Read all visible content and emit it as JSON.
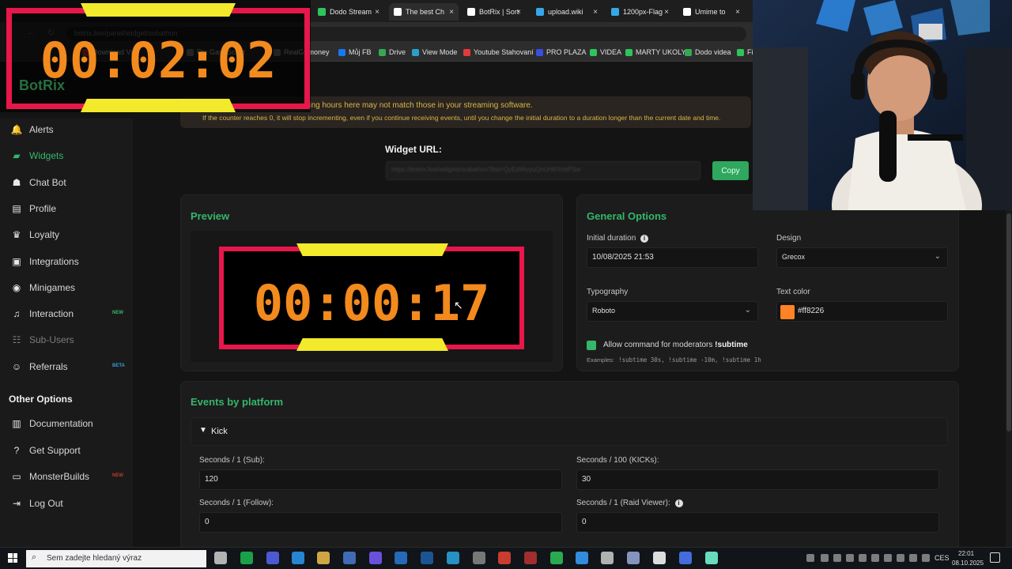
{
  "overlay_timer": {
    "time": "00:02:02",
    "brand": "BotRix"
  },
  "browser": {
    "tabs": [
      {
        "label": "Dodo Stream",
        "color": "#2ec45b",
        "active": false
      },
      {
        "label": "The best Ch",
        "color": "#ffffff",
        "active": true
      },
      {
        "label": "BotRix | Sort",
        "color": "#ffffff",
        "active": false
      },
      {
        "label": "upload.wiki",
        "color": "#36a6e8",
        "active": false
      },
      {
        "label": "1200px-Flag",
        "color": "#36a6e8",
        "active": false
      },
      {
        "label": "Umime to",
        "color": "#ffffff",
        "active": false
      }
    ],
    "url": "botrix.live/panel/widget/subathon",
    "bookmarks": [
      {
        "label": "Download Vi",
        "color": "#e23b3b"
      },
      {
        "label": "Rtx Gam Script",
        "color": "#888888"
      },
      {
        "label": "RealGemoney",
        "color": "#888888"
      },
      {
        "label": "Můj FB",
        "color": "#1877f2"
      },
      {
        "label": "Drive",
        "color": "#34a853"
      },
      {
        "label": "View Mode",
        "color": "#2aa0c8"
      },
      {
        "label": "Youtube Stahovaní",
        "color": "#e23b3b"
      },
      {
        "label": "PRO PLAZA",
        "color": "#3b4de2"
      },
      {
        "label": "VIDEA",
        "color": "#2ec45b"
      },
      {
        "label": "MARTY UKOLY",
        "color": "#2ec45b"
      },
      {
        "label": "Dodo videa",
        "color": "#34a853"
      },
      {
        "label": "Fi",
        "color": "#2ec45b"
      }
    ]
  },
  "banner": {
    "line1": "aining hours here may not match those in your streaming software.",
    "line2": "If the counter reaches 0, it will stop incrementing, even if you continue receiving events, until you change the initial duration to a duration longer than the current date and time."
  },
  "sidebar": {
    "items": [
      {
        "label": "Alerts",
        "icon": "bell-icon",
        "glyph": "🔔",
        "state": "normal"
      },
      {
        "label": "Widgets",
        "icon": "layers-icon",
        "glyph": "▰",
        "state": "active"
      },
      {
        "label": "Chat Bot",
        "icon": "robot-icon",
        "glyph": "☗",
        "state": "normal"
      },
      {
        "label": "Profile",
        "icon": "id-card-icon",
        "glyph": "▤",
        "state": "normal"
      },
      {
        "label": "Loyalty",
        "icon": "trophy-icon",
        "glyph": "♛",
        "state": "normal"
      },
      {
        "label": "Integrations",
        "icon": "plug-icon",
        "glyph": "▣",
        "state": "normal"
      },
      {
        "label": "Minigames",
        "icon": "gamepad-icon",
        "glyph": "◉",
        "state": "normal"
      },
      {
        "label": "Interaction",
        "icon": "music-icon",
        "glyph": "♫",
        "state": "normal",
        "badge": "NEW",
        "badge_color": "#35b66a"
      },
      {
        "label": "Sub-Users",
        "icon": "users-icon",
        "glyph": "☷",
        "state": "disabled"
      },
      {
        "label": "Referrals",
        "icon": "user-group-icon",
        "glyph": "☺",
        "state": "normal",
        "badge": "BETA",
        "badge_color": "#3a9bd6"
      }
    ],
    "other_title": "Other Options",
    "other_items": [
      {
        "label": "Documentation",
        "icon": "book-icon",
        "glyph": "▥"
      },
      {
        "label": "Get Support",
        "icon": "help-icon",
        "glyph": "?"
      },
      {
        "label": "MonsterBuilds",
        "icon": "laptop-icon",
        "glyph": "▭",
        "badge": "NEW",
        "badge_color": "#c0392b"
      },
      {
        "label": "Log Out",
        "icon": "logout-icon",
        "glyph": "⇥"
      }
    ]
  },
  "widget_url": {
    "label": "Widget URL:",
    "value": "https://botrix.live/widgets/subathon?bid=QyEdWyyuQnUrWXnbPSw",
    "copy_label": "Copy"
  },
  "preview": {
    "title": "Preview",
    "time": "00:00:17"
  },
  "general": {
    "title": "General Options",
    "initial_duration_label": "Initial duration",
    "initial_duration_value": "10/08/2025 21:53",
    "design_label": "Design",
    "design_value": "Grecox",
    "typography_label": "Typography",
    "typography_value": "Roboto",
    "text_color_label": "Text color",
    "text_color_value": "#ff8226",
    "text_color_hex": "#ff8226",
    "allow_label": "Allow command for moderators",
    "allow_command": "!subtime",
    "examples_label": "Examples:",
    "examples": "!subtime 30s, !subtime -10m, !subtime 1h"
  },
  "events": {
    "title": "Events by platform",
    "platform": "Kick",
    "fields": [
      {
        "label": "Seconds / 1 (Sub):",
        "value": "120"
      },
      {
        "label": "Seconds / 100 (KICKs):",
        "value": "30"
      },
      {
        "label": "Seconds / 1 (Follow):",
        "value": "0"
      },
      {
        "label": "Seconds / 1 (Raid Viewer):",
        "value": "0"
      }
    ]
  },
  "taskbar": {
    "search_placeholder": "Sem zadejte hledaný výraz",
    "lang": "CES",
    "time": "22:01",
    "date": "08.10.2025"
  },
  "colors": {
    "accent": "#35b66a",
    "timer_border": "#e8174b",
    "timer_bar": "#f2ea2b",
    "timer_text": "#f28a1e"
  }
}
